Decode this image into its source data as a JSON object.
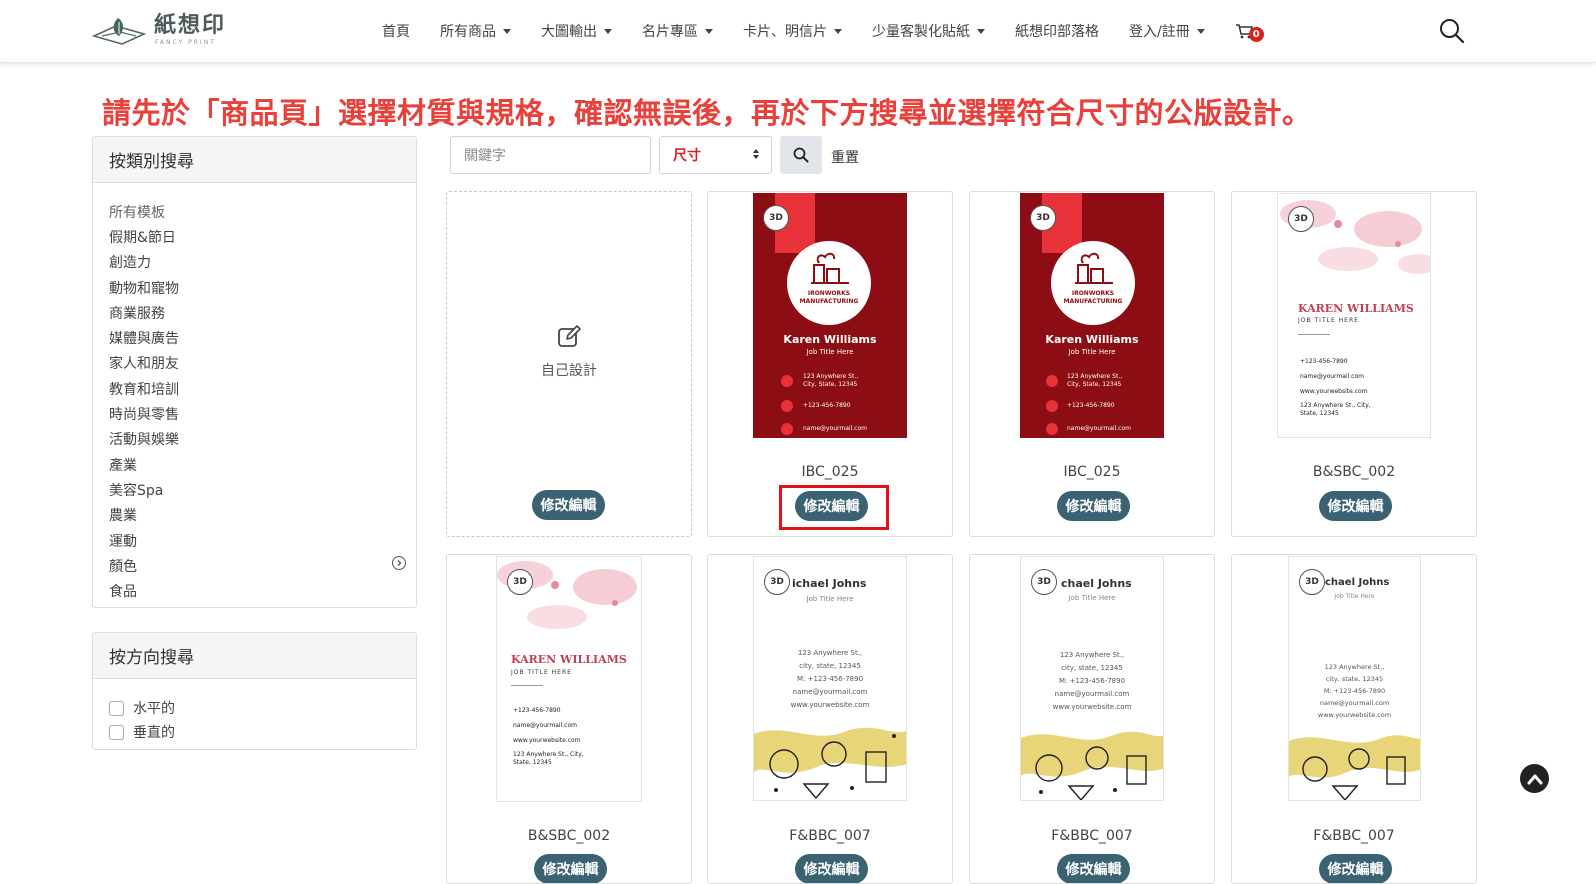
{
  "brand": {
    "name": "紙想印",
    "tagline": "FANCY PRINT"
  },
  "nav": [
    {
      "label": "首頁",
      "caret": false
    },
    {
      "label": "所有商品",
      "caret": true
    },
    {
      "label": "大圖輸出",
      "caret": true
    },
    {
      "label": "名片專區",
      "caret": true
    },
    {
      "label": "卡片、明信片",
      "caret": true
    },
    {
      "label": "少量客製化貼紙",
      "caret": true
    },
    {
      "label": "紙想印部落格",
      "caret": false
    },
    {
      "label": "登入/註冊",
      "caret": true
    }
  ],
  "cart": {
    "count": "0"
  },
  "notice": "請先於「商品頁」選擇材質與規格，確認無誤後，再於下方搜尋並選擇符合尺寸的公版設計。",
  "sidebar": {
    "category_title": "按類別搜尋",
    "categories": [
      "所有模板",
      "假期&節日",
      "創造力",
      "動物和寵物",
      "商業服務",
      "媒體與廣告",
      "家人和朋友",
      "教育和培訓",
      "時尚與零售",
      "活動與娛樂",
      "產業",
      "美容Spa",
      "農業",
      "運動",
      "顏色",
      "食品"
    ],
    "direction_title": "按方向搜尋",
    "directions": [
      "水平的",
      "垂直的"
    ]
  },
  "search": {
    "keyword_placeholder": "關鍵字",
    "size_label": "尺寸",
    "reset_label": "重置"
  },
  "self_design": {
    "label": "自己設計",
    "button": "修改編輯"
  },
  "templates": [
    {
      "code": "IBC_025",
      "button": "修改編輯",
      "style": "red",
      "name": "Karen Williams",
      "job": "Job Title Here",
      "company": "IRONWORKS MANUFACTURING",
      "address": "123 Anywhere St., City, State, 12345",
      "phone": "+123-456-7890",
      "email": "name@yourmail.com"
    },
    {
      "code": "IBC_025",
      "button": "修改編輯",
      "style": "red",
      "name": "Karen Williams",
      "job": "Job Title Here",
      "company": "IRONWORKS MANUFACTURING",
      "address": "123 Anywhere St., City, State, 12345",
      "phone": "+123-456-7890",
      "email": "name@yourmail.com"
    },
    {
      "code": "B&SBC_002",
      "button": "修改編輯",
      "style": "floral",
      "name": "KAREN WILLIAMS",
      "job": "JOB TITLE HERE",
      "phone": "+123-456-7890",
      "email": "name@yourmail.com",
      "web": "www.yourwebsite.com",
      "address": "123 Anywhere St., City, State, 12345"
    },
    {
      "code": "B&SBC_002",
      "button": "修改編輯",
      "style": "floral",
      "name": "KAREN WILLIAMS",
      "job": "JOB TITLE HERE",
      "phone": "+123-456-7890",
      "email": "name@yourmail.com",
      "web": "www.yourwebsite.com",
      "address": "123 Anywhere St., City, State, 12345"
    },
    {
      "code": "F&BBC_007",
      "button": "修改編輯",
      "style": "food",
      "name": "ichael Johns",
      "job": "Job Title Here",
      "address1": "123 Anywhere St.,",
      "address2": "city, state, 12345",
      "phone": "M: +123-456-7890",
      "email": "name@yourmail.com",
      "web": "www.yourwebsite.com"
    },
    {
      "code": "F&BBC_007",
      "button": "修改編輯",
      "style": "food",
      "name": "chael Johns",
      "job": "Job Title Here",
      "address1": "123 Anywhere St.,",
      "address2": "city, state, 12345",
      "phone": "M: +123-456-7890",
      "email": "name@yourmail.com",
      "web": "www.yourwebsite.com"
    },
    {
      "code": "F&BBC_007",
      "button": "修改編輯",
      "style": "food",
      "name": "chael Johns",
      "job": "Job Title Here",
      "address1": "123 Anywhere St.,",
      "address2": "city, state, 12345",
      "phone": "M: +123-456-7890",
      "email": "name@yourmail.com",
      "web": "www.yourwebsite.com"
    }
  ],
  "badge_3d": "3D",
  "colors": {
    "accent": "#3a6273",
    "notice": "#e8403a",
    "card_red": "#8c0e14",
    "card_red_top": "#e8323a",
    "highlight": "#e3111a"
  },
  "icons": {
    "search": "search-icon",
    "cart": "cart-icon",
    "edit": "edit-icon",
    "back_to_top": "arrow-up-icon"
  }
}
